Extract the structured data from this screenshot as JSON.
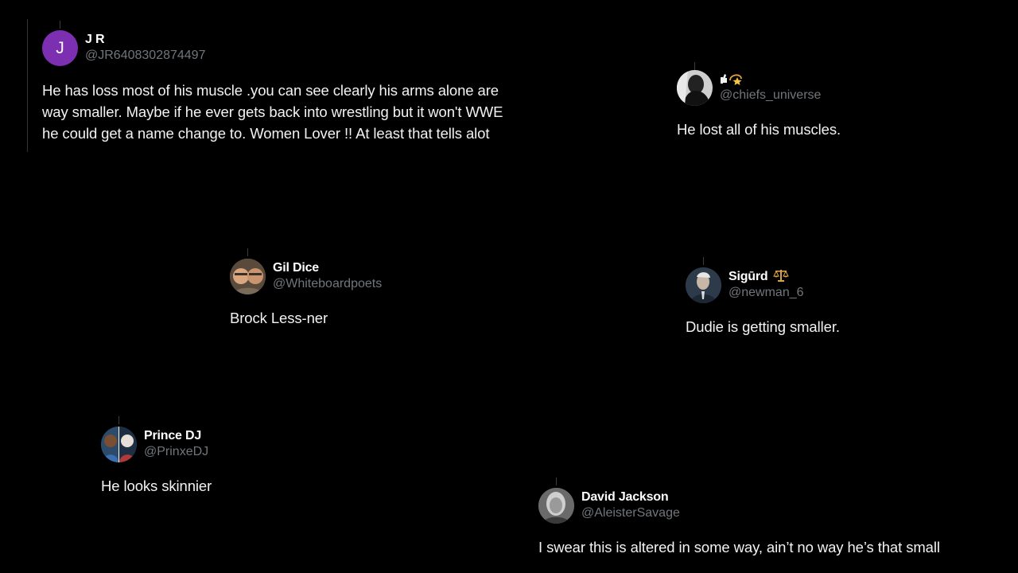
{
  "tweets": [
    {
      "id": "jr",
      "display_name": "J R",
      "handle": "@JR6408302874497",
      "avatar_letter": "J",
      "avatar_color": "#7c2fb1",
      "text_lines": [
        "He has loss most of his muscle .you can see clearly his arms alone are",
        "way smaller. Maybe if he ever gets back into wrestling but it won't WWE",
        "he could get a name change to.  Women Lover !!  At least that tells alot"
      ]
    },
    {
      "id": "chiefs",
      "display_name": "",
      "display_icons": [
        "thumbs-up-icon",
        "dizzy-star-icon"
      ],
      "handle": "@chiefs_universe",
      "text": "He lost all of his muscles."
    },
    {
      "id": "gil",
      "display_name": "Gil Dice",
      "handle": "@Whiteboardpoets",
      "text": "Brock Less-ner"
    },
    {
      "id": "sigurd",
      "display_name": "Sigūrd",
      "display_icons": [
        "balance-scale-icon"
      ],
      "handle": "@newman_6",
      "text": "Dudie is getting smaller."
    },
    {
      "id": "prince",
      "display_name": "Prince DJ",
      "handle": "@PrinxeDJ",
      "text": "He looks skinnier"
    },
    {
      "id": "david",
      "display_name": "David Jackson",
      "handle": "@AleisterSavage",
      "text": "I swear this is altered in some way, ain’t no way he’s that small"
    }
  ],
  "colors": {
    "background": "#000000",
    "text_primary": "#e7e9ea",
    "text_secondary": "#71767b",
    "divider": "#2f3336"
  }
}
